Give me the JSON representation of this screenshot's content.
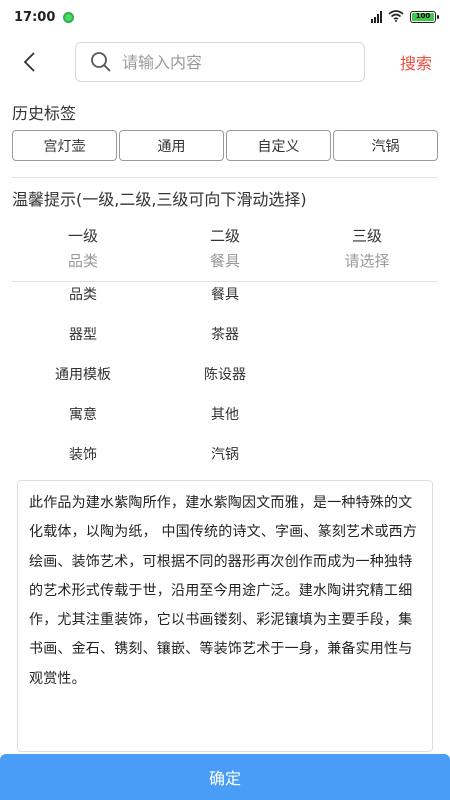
{
  "status": {
    "time": "17:00",
    "battery": "100"
  },
  "header": {
    "search_placeholder": "请输入内容",
    "search_label": "搜索"
  },
  "history": {
    "title": "历史标签",
    "tags": [
      "宫灯壶",
      "通用",
      "自定义",
      "汽锅"
    ]
  },
  "tip": "温馨提示(一级,二级,三级可向下滑动选择)",
  "levels": [
    {
      "head": "一级",
      "selected": "品类"
    },
    {
      "head": "二级",
      "selected": "餐具"
    },
    {
      "head": "三级",
      "selected": "请选择"
    }
  ],
  "lists": {
    "level1": [
      "品类",
      "器型",
      "通用模板",
      "寓意",
      "装饰"
    ],
    "level2": [
      "餐具",
      "茶器",
      "陈设器",
      "其他",
      "汽锅"
    ]
  },
  "description": "此作品为建水紫陶所作，建水紫陶因文而雅，是一种特殊的文化载体，以陶为纸， 中国传统的诗文、字画、篆刻艺术或西方绘画、装饰艺术，可根据不同的器形再次创作而成为一种独特的艺术形式传载于世，沿用至今用途广泛。建水陶讲究精工细作，尤其注重装饰，它以书画镂刻、彩泥镶填为主要手段，集书画、金石、镌刻、镶嵌、等装饰艺术于一身，兼备实用性与观赏性。",
  "confirm_label": "确定",
  "colors": {
    "accent": "#4a9df6",
    "search": "#e84c3d"
  }
}
